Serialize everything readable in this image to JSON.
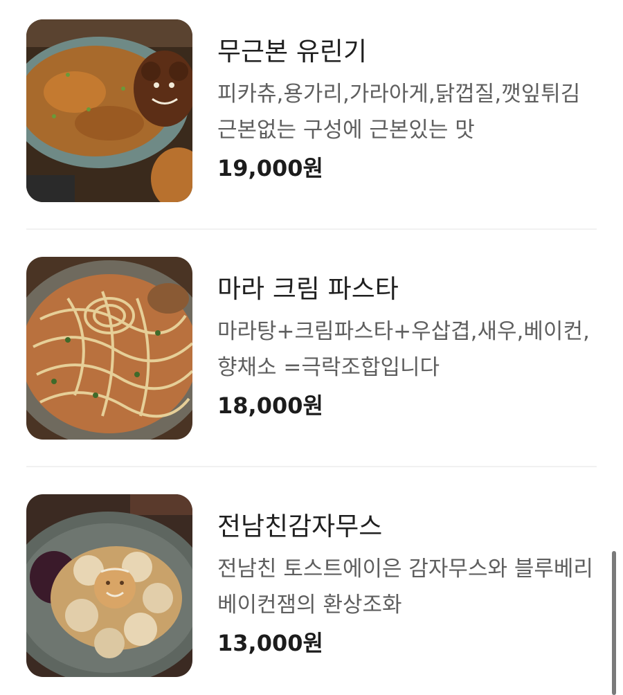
{
  "menu": {
    "items": [
      {
        "name": "무근본 유린기",
        "description": "피카츄,용가리,가라아게,닭껍질,깻잎튀김 근본없는 구성에 근본있는 맛",
        "price": "19,000원",
        "image_icon": "food-photo-icon"
      },
      {
        "name": "마라 크림 파스타",
        "description": "마라탕+크림파스타+우삽겹,새우,베이컨,향채소 =극락조합입니다",
        "price": "18,000원",
        "image_icon": "food-photo-icon"
      },
      {
        "name": "전남친감자무스",
        "description": "전남친 토스트에이은 감자무스와 블루베리베이컨잼의 환상조화",
        "price": "13,000원",
        "image_icon": "food-photo-icon"
      }
    ]
  }
}
